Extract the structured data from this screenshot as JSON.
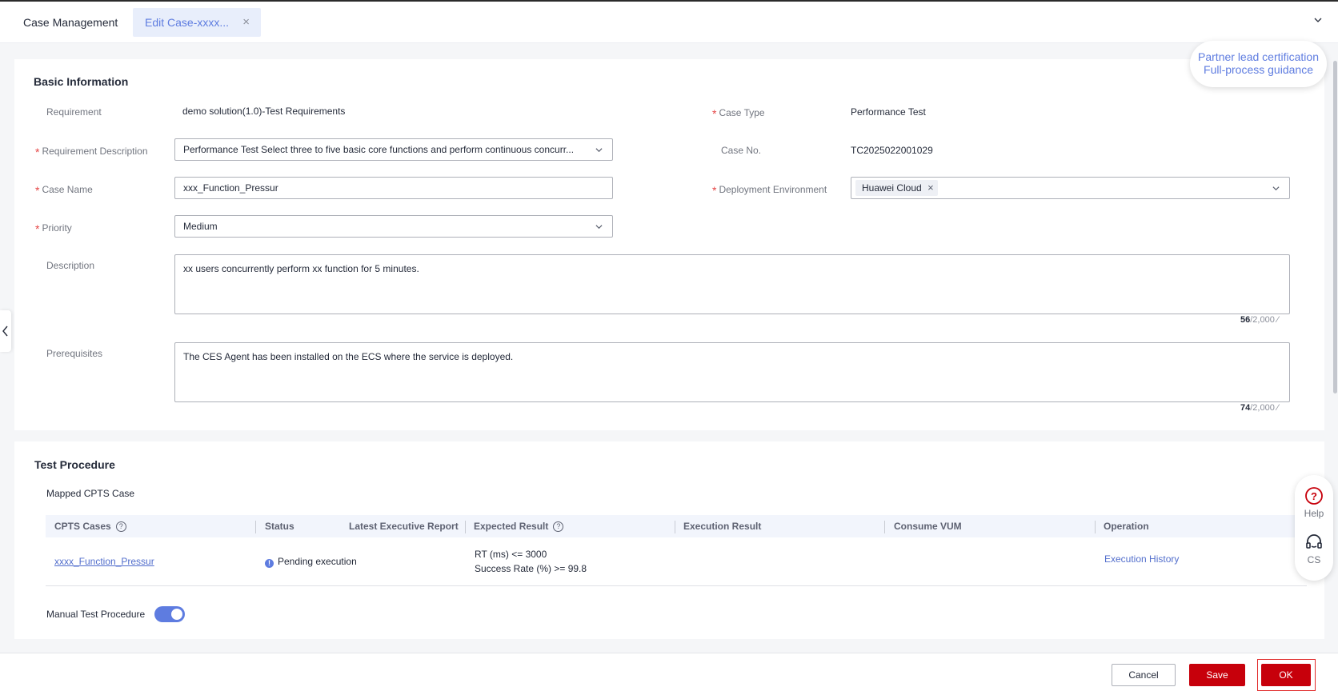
{
  "tabs": {
    "case_management": "Case Management",
    "edit_case": "Edit Case-xxxx...",
    "close_symbol": "×"
  },
  "guide": {
    "line1": "Partner lead certification",
    "line2": "Full-process guidance"
  },
  "basic": {
    "title": "Basic Information",
    "requirement_label": "Requirement",
    "requirement_value": "demo solution(1.0)-Test Requirements",
    "case_type_label": "Case Type",
    "case_type_value": "Performance Test",
    "req_desc_label": "Requirement Description",
    "req_desc_value": "Performance Test Select three to five basic core functions and perform continuous concurr...",
    "case_no_label": "Case No.",
    "case_no_value": "TC2025022001029",
    "case_name_label": "Case Name",
    "case_name_value": "xxx_Function_Pressur",
    "deploy_env_label": "Deployment Environment",
    "deploy_env_tag": "Huawei Cloud",
    "priority_label": "Priority",
    "priority_value": "Medium",
    "description_label": "Description",
    "description_value": "xx users concurrently perform xx function for 5 minutes.",
    "description_count": "56",
    "description_max": "/2,000",
    "prerequisites_label": "Prerequisites",
    "prerequisites_value": "The CES Agent has been installed on the ECS where the service is deployed.",
    "prerequisites_count": "74",
    "prerequisites_max": "/2,000",
    "required_mark": "*"
  },
  "procedure": {
    "title": "Test Procedure",
    "mapped_label": "Mapped CPTS Case",
    "columns": {
      "cpts_cases": "CPTS Cases",
      "status": "Status",
      "latest_report": "Latest Executive Report",
      "expected_result": "Expected Result",
      "execution_result": "Execution Result",
      "consume_vum": "Consume VUM",
      "operation": "Operation"
    },
    "row": {
      "case_link": "xxxx_Function_Pressur",
      "status": "Pending execution",
      "expected_line1": "RT (ms) <= 3000",
      "expected_line2": "Success Rate (%) >= 99.8",
      "operation": "Execution History"
    },
    "manual_label": "Manual Test Procedure",
    "manual_enabled": true
  },
  "float": {
    "help": "Help",
    "cs": "CS"
  },
  "footer": {
    "cancel": "Cancel",
    "save": "Save",
    "ok": "OK"
  },
  "colors": {
    "brand_red": "#c7000b",
    "accent_blue": "#5e7ce0",
    "link_blue": "#526ecc"
  }
}
